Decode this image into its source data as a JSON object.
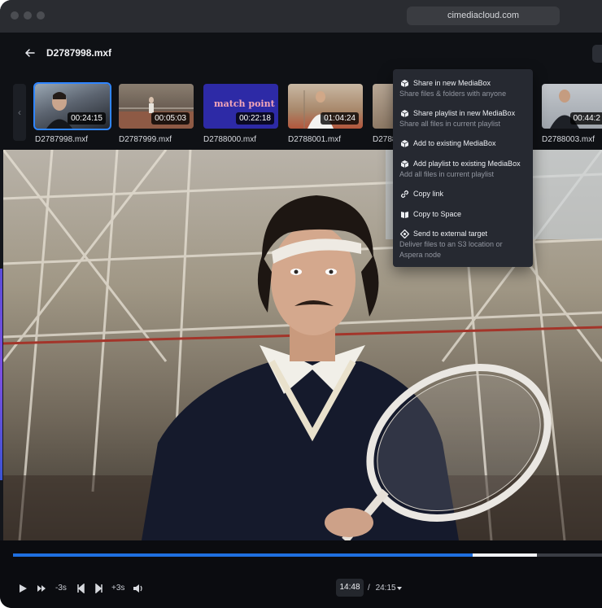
{
  "browser": {
    "url": "cimediacloud.com"
  },
  "header": {
    "title": "D2787998.mxf"
  },
  "filmstrip": {
    "items": [
      {
        "name": "D2787998.mxf",
        "duration": "00:24:15",
        "selected": true
      },
      {
        "name": "D2787999.mxf",
        "duration": "00:05:03"
      },
      {
        "name": "D2788000.mxf",
        "duration": "00:22:18",
        "poster_text": "match point"
      },
      {
        "name": "D2788001.mxf",
        "duration": "01:04:24"
      },
      {
        "name": "D2788002.mxf"
      },
      {
        "name": "D2788003.mxf",
        "duration": "00:44:2"
      }
    ]
  },
  "menu": {
    "items": [
      {
        "icon": "cube-icon",
        "label": "Share in new MediaBox",
        "sub": "Share files & folders with anyone"
      },
      {
        "icon": "cube-icon",
        "label": "Share playlist in new MediaBox",
        "sub": "Share all files in current playlist"
      },
      {
        "icon": "cube-icon",
        "label": "Add to existing MediaBox",
        "sub": ""
      },
      {
        "icon": "cube-icon",
        "label": "Add playlist to existing MediaBox",
        "sub": "Add all files in current playlist"
      },
      {
        "icon": "link-icon",
        "label": "Copy link",
        "sub": ""
      },
      {
        "icon": "book-icon",
        "label": "Copy to Space",
        "sub": ""
      },
      {
        "icon": "diamond-icon",
        "label": "Send to external target",
        "sub1": "Deliver files to an S3 location or",
        "sub2": "Aspera node"
      }
    ]
  },
  "player": {
    "skip_back_label": "-3s",
    "skip_fwd_label": "+3s",
    "current_time": "14:48",
    "separator": "/",
    "total_time": "24:15",
    "progress_played": 0.78,
    "progress_buffered": 0.89
  },
  "colors": {
    "accent": "#1f6fe0",
    "menu_bg": "#262931",
    "app_bg": "#0f1115"
  }
}
